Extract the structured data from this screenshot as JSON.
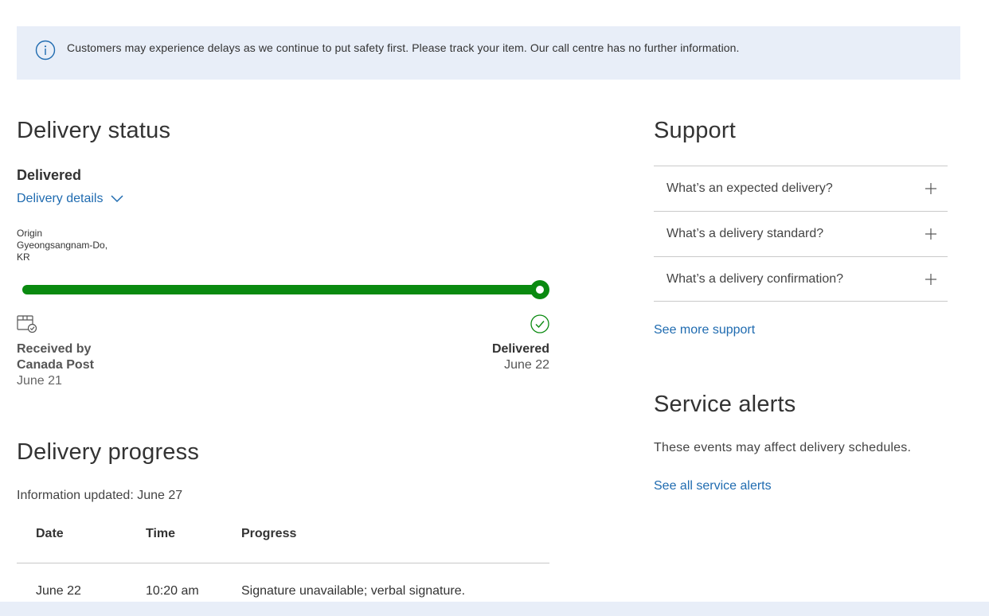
{
  "notice": {
    "icon": "info-icon",
    "text": "Customers may experience delays as we continue to put safety first. Please track your item. Our call centre has no further information."
  },
  "delivery_status": {
    "heading": "Delivery status",
    "status": "Delivered",
    "details_link": "Delivery details",
    "origin_label": "Origin",
    "origin_place": "Gyeongsangnam-Do, KR",
    "progress_fraction": 1.0,
    "start": {
      "icon": "package-received-icon",
      "label_line1": "Received by",
      "label_line2": "Canada Post",
      "date": "June 21"
    },
    "end": {
      "icon": "check-circle-icon",
      "label": "Delivered",
      "date": "June 22"
    }
  },
  "delivery_progress": {
    "heading": "Delivery progress",
    "updated": "Information updated: June 27",
    "columns": [
      "Date",
      "Time",
      "Progress"
    ],
    "rows": [
      {
        "date": "June 22",
        "time": "10:20 am",
        "progress": "Signature unavailable; verbal signature."
      }
    ]
  },
  "support": {
    "heading": "Support",
    "items": [
      {
        "label": "What’s an expected delivery?"
      },
      {
        "label": "What’s a delivery standard?"
      },
      {
        "label": "What’s a delivery confirmation?"
      }
    ],
    "more_link": "See more support"
  },
  "service_alerts": {
    "heading": "Service alerts",
    "text": "These events may affect delivery schedules.",
    "link": "See all service alerts"
  },
  "colors": {
    "accent_link": "#1f6bb0",
    "progress_green": "#0a8a10",
    "notice_bg": "#e8eef8"
  }
}
